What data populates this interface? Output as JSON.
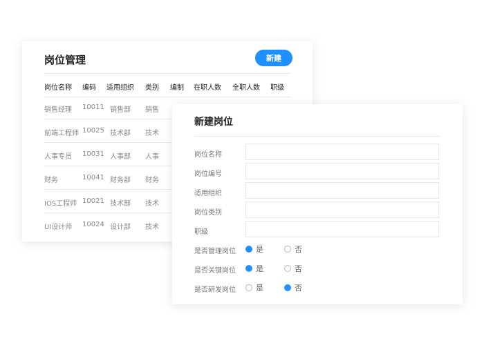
{
  "list": {
    "title": "岗位管理",
    "new_button": "新建",
    "headers": [
      "岗位名称",
      "编码",
      "适用组织",
      "类别",
      "编制",
      "在职人数",
      "全职人数",
      "职级"
    ],
    "rows": [
      [
        "销售经理",
        "10011",
        "销售部",
        "销售"
      ],
      [
        "前端工程师",
        "10025",
        "技术部",
        "技术"
      ],
      [
        "人事专员",
        "10031",
        "人事部",
        "人事"
      ],
      [
        "财务",
        "10041",
        "财务部",
        "财务"
      ],
      [
        "IOS工程师",
        "10021",
        "技术部",
        "技术"
      ],
      [
        "UI设计师",
        "10024",
        "设计部",
        "技术"
      ]
    ]
  },
  "form": {
    "title": "新建岗位",
    "fields": [
      "岗位名称",
      "岗位编号",
      "适用组织",
      "岗位类别",
      "职级"
    ],
    "radios": [
      {
        "label": "是否管理岗位",
        "yes": "是",
        "no": "否",
        "selected": "yes"
      },
      {
        "label": "是否关键岗位",
        "yes": "是",
        "no": "否",
        "selected": "yes"
      },
      {
        "label": "是否研发岗位",
        "yes": "是",
        "no": "否",
        "selected": "no"
      }
    ]
  },
  "colors": {
    "accent": "#1e90ff"
  }
}
